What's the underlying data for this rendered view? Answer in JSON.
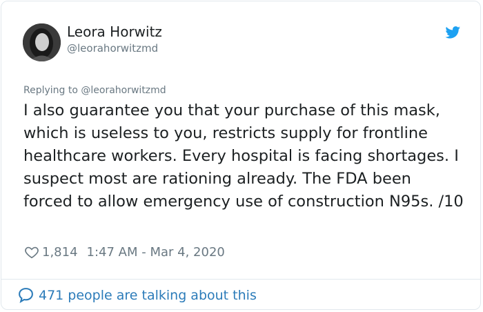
{
  "author": {
    "name": "Leora Horwitz",
    "handle": "@leorahorwitzmd",
    "avatar_icon": "avatar-photo"
  },
  "brand": {
    "icon": "twitter-bird-icon",
    "color": "#1da1f2"
  },
  "reply": {
    "text": "Replying to @leorahorwitzmd"
  },
  "tweet": {
    "text": "I also guarantee you that your purchase of this mask, which is useless to you, restricts supply for frontline healthcare workers. Every hospital is facing shortages. I suspect most are rationing already. The FDA been forced to allow emergency use of construction N95s. /10"
  },
  "meta": {
    "likes": "1,814",
    "timestamp": "1:47 AM - Mar 4, 2020",
    "heart_icon": "heart-icon"
  },
  "footer": {
    "talking": "471 people are talking about this",
    "bubble_icon": "speech-bubble-icon",
    "link_color": "#2b7bb9"
  }
}
